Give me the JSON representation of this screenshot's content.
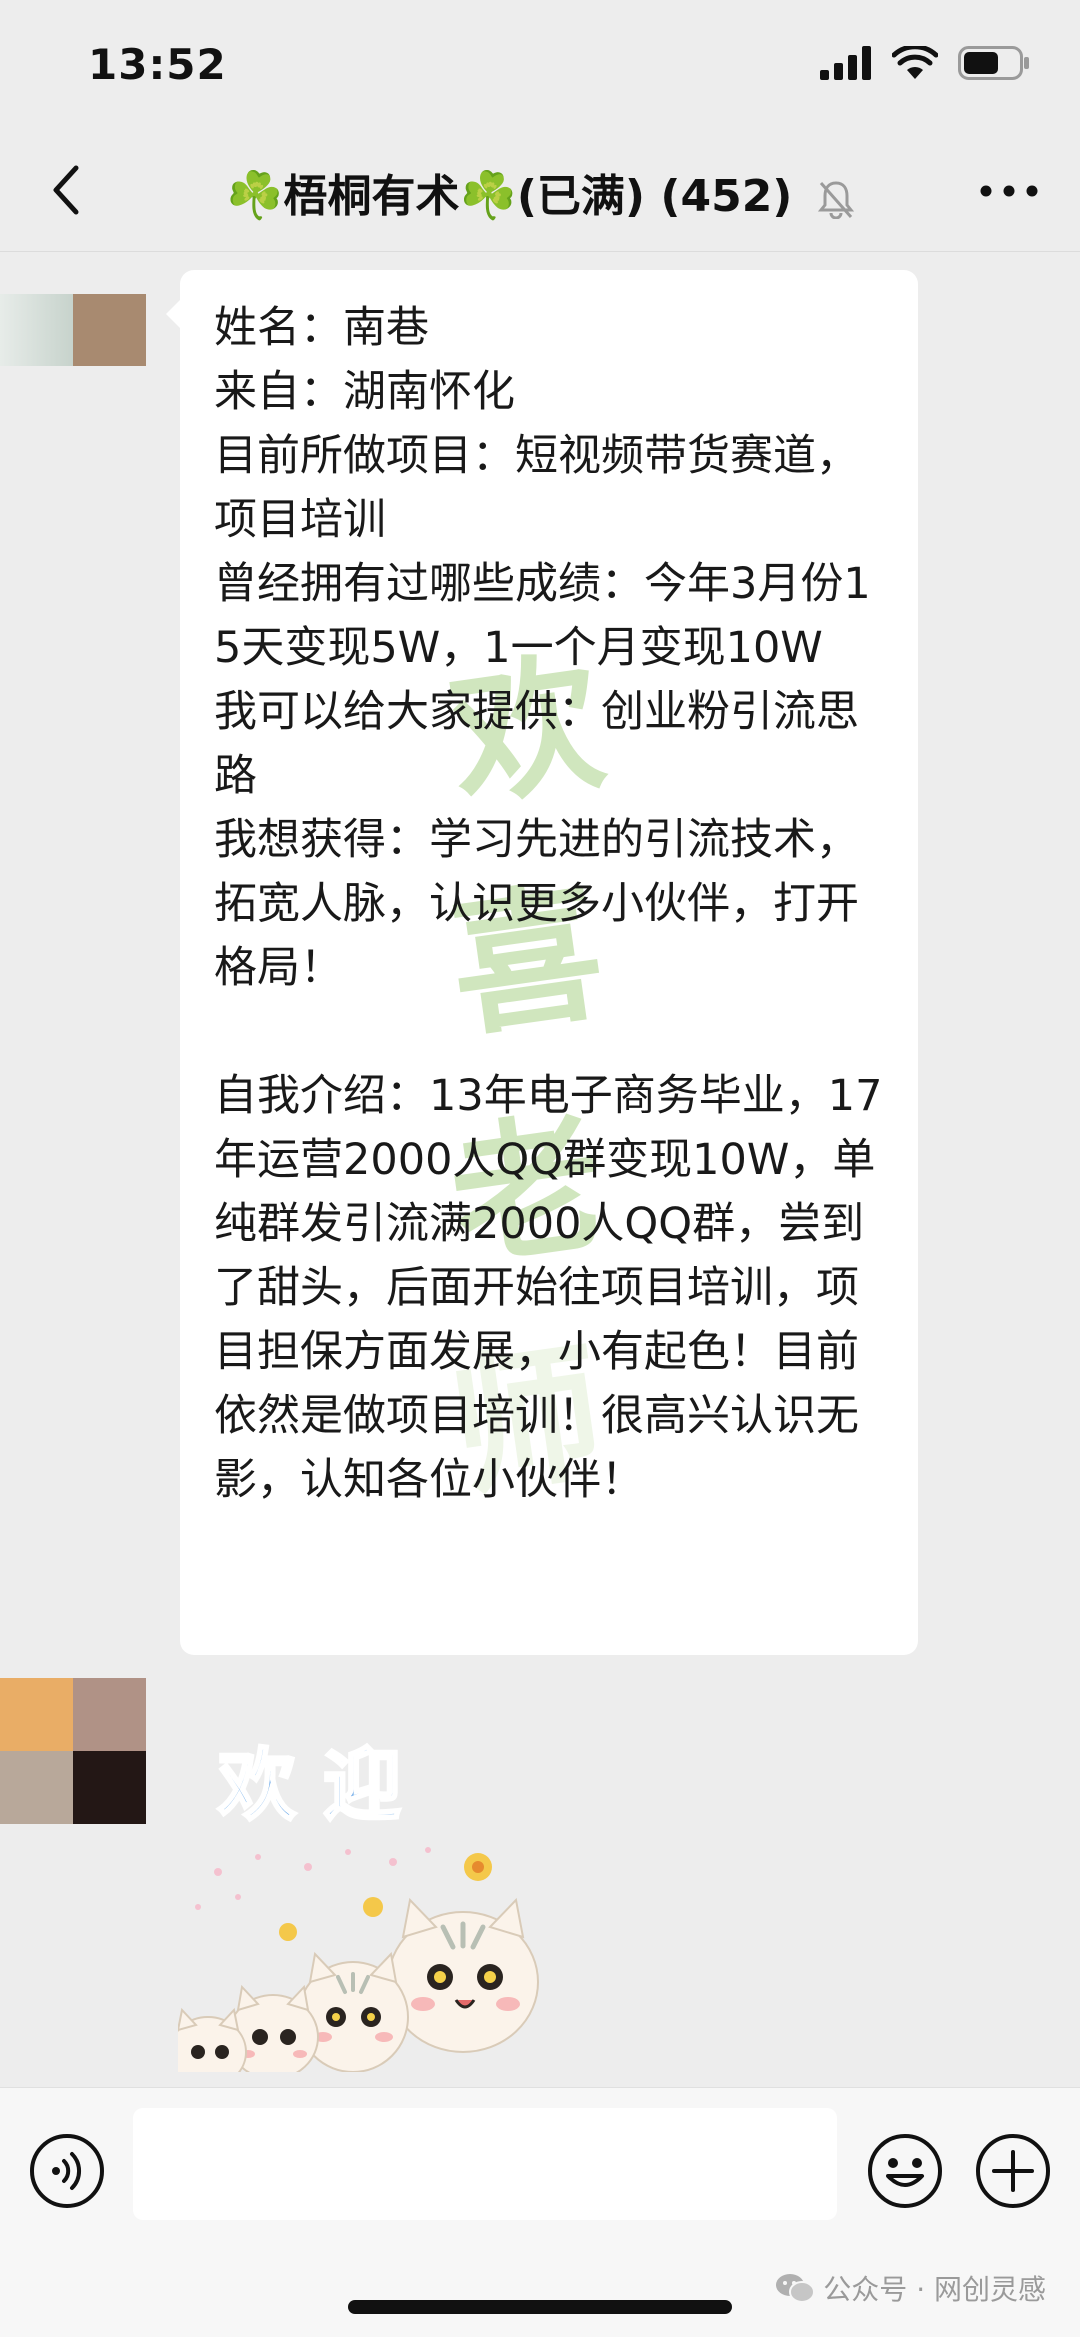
{
  "status_bar": {
    "time": "13:52"
  },
  "nav": {
    "clover_left": "☘️",
    "group_name": "梧桐有术",
    "clover_right": "☘️",
    "suffix": "(已满) (452)"
  },
  "message": {
    "text": "姓名：南巷\n来自：湖南怀化\n目前所做项目：短视频带货赛道，项目培训\n曾经拥有过哪些成绩：今年3月份15天变现5W，1一个月变现10W\n我可以给大家提供：创业粉引流思路\n我想获得：学习先进的引流技术，拓宽人脉，认识更多小伙伴，打开格局！\n\n自我介绍：13年电子商务毕业，17年运营2000人QQ群变现10W，单纯群发引流满2000人QQ群，尝到了甜头，后面开始往项目培训，项目担保方面发展，小有起色！目前依然是做项目培训！很高兴认识无影，认知各位小伙伴！",
    "watermark_chars": [
      "欢",
      "喜",
      "老",
      "师"
    ]
  },
  "sticker": {
    "text": "欢 迎"
  },
  "footer": {
    "watermark": "公众号 · 网创灵感"
  },
  "colors": {
    "background": "#ededed",
    "bubble": "#ffffff",
    "watermark_green": "#96c86e",
    "sticker_blue": "#6aa8e8"
  }
}
